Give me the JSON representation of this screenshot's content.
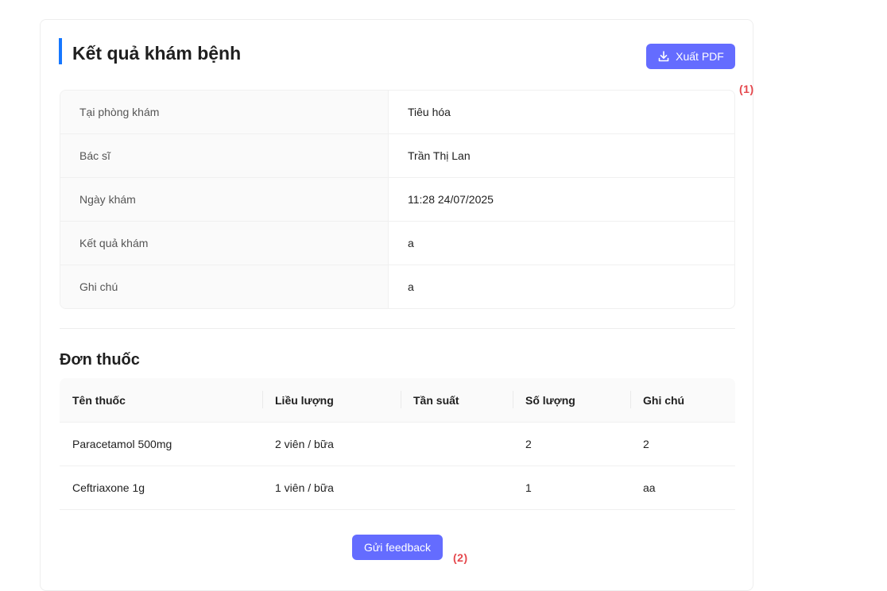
{
  "header": {
    "title": "Kết quả khám bệnh",
    "export_pdf_label": "Xuất PDF",
    "accent_color": "#1677ff",
    "button_color": "#646cff"
  },
  "annotations": {
    "marker_1": "(1)",
    "marker_2": "(2)"
  },
  "details": [
    {
      "label": "Tại phòng khám",
      "value": "Tiêu hóa"
    },
    {
      "label": "Bác sĩ",
      "value": "Trần Thị Lan"
    },
    {
      "label": "Ngày khám",
      "value": "11:28 24/07/2025"
    },
    {
      "label": "Kết quả khám",
      "value": "a"
    },
    {
      "label": "Ghi chú",
      "value": "a"
    }
  ],
  "prescription": {
    "title": "Đơn thuốc",
    "columns": [
      "Tên thuốc",
      "Liều lượng",
      "Tần suất",
      "Số lượng",
      "Ghi chú"
    ],
    "rows": [
      [
        "Paracetamol 500mg",
        "2 viên / bữa",
        "",
        "2",
        "2"
      ],
      [
        "Ceftriaxone 1g",
        "1 viên / bữa",
        "",
        "1",
        "aa"
      ]
    ]
  },
  "footer": {
    "feedback_label": "Gửi feedback"
  },
  "icons": {
    "export": "download-icon"
  }
}
